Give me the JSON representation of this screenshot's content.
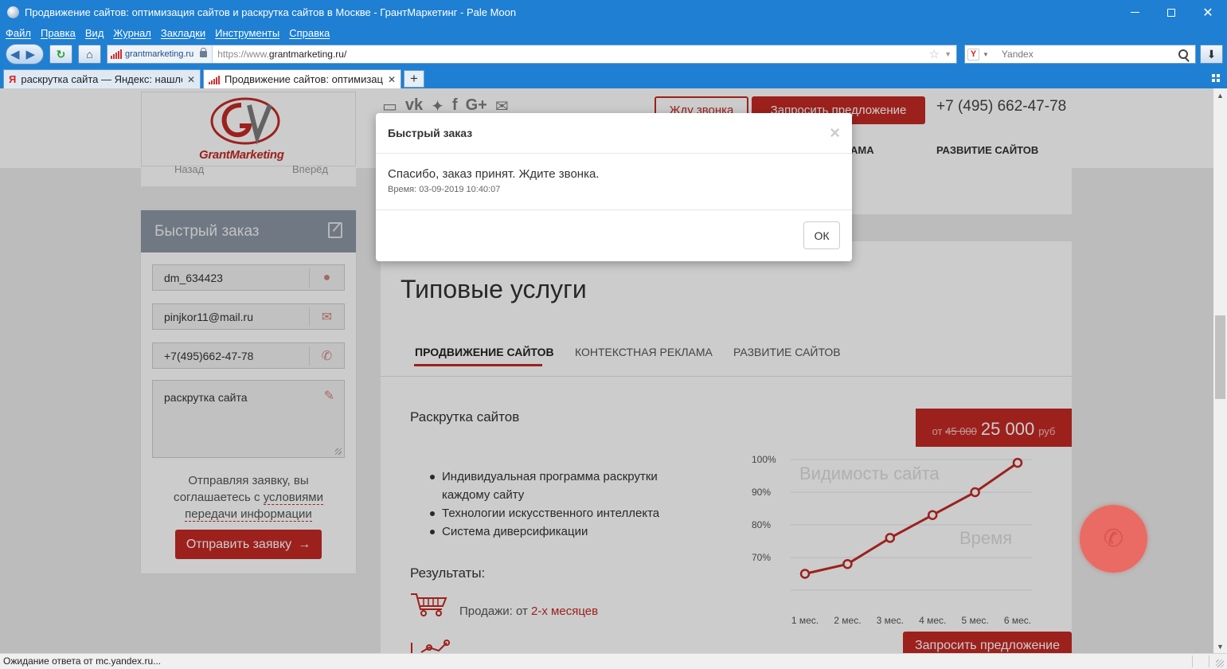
{
  "window": {
    "title": "Продвижение сайтов: оптимизация сайтов и раскрутка сайтов в Москве - ГрантМаркетинг - Pale Moon"
  },
  "menu": [
    "Файл",
    "Правка",
    "Вид",
    "Журнал",
    "Закладки",
    "Инструменты",
    "Справка"
  ],
  "urlbar": {
    "site_badge": "grantmarketing.ru",
    "url_prefix": "https://www.",
    "url_host": "grantmarketing.ru/"
  },
  "searchbar": {
    "engine": "Yandex",
    "badge": "Y"
  },
  "tabs": [
    {
      "label": "раскрутка сайта — Яндекс: нашло...",
      "favicon": "Я",
      "active": false
    },
    {
      "label": "Продвижение сайтов: оптимизац...",
      "active": true
    }
  ],
  "site": {
    "logo_text": "GrantMarketing",
    "call_button": "Жду звонка",
    "offer_button": "Запросить предложение",
    "phone": "+7 (495) 662-47-78",
    "nav_partial": "АМА",
    "nav_item": "РАЗВИТИЕ САЙТОВ",
    "under_left": "Назад",
    "under_right": "Вперёд"
  },
  "quick_order": {
    "title": "Быстрый заказ",
    "name": "dm_634423",
    "email": "pinjkor11@mail.ru",
    "phone": "+7(495)662-47-78",
    "message": "раскрутка сайта",
    "agree_before": "Отправляя заявку, вы соглашаетесь с ",
    "agree_link": "условиями передачи информации",
    "send_button": "Отправить заявку"
  },
  "services": {
    "title": "Типовые услуги",
    "tabs": [
      "ПРОДВИЖЕНИЕ САЙТОВ",
      "КОНТЕКСТНАЯ РЕКЛАМА",
      "РАЗВИТИЕ САЙТОВ"
    ],
    "offer_title": "Раскрутка сайтов",
    "price": {
      "from": "от",
      "old": "45 000",
      "new": "25 000",
      "currency": "руб"
    },
    "bullets": [
      "Индивидуальная программа раскрутки каждому сайту",
      "Технологии искусственного интеллекта",
      "Система диверсификации"
    ],
    "results_title": "Результаты:",
    "sales_label": "Продажи: от ",
    "sales_value": "2-х месяцев",
    "offer_button": "Запросить предложение"
  },
  "chart_data": {
    "type": "line",
    "title": "Видимость сайта",
    "xlabel": "Время",
    "categories": [
      "1 мес.",
      "2 мес.",
      "3 мес.",
      "4 мес.",
      "5 мес.",
      "6 мес."
    ],
    "series": [
      {
        "values": [
          65,
          68,
          76,
          83,
          90,
          99
        ]
      }
    ],
    "yticks": [
      "100%",
      "90%",
      "80%",
      "70%"
    ],
    "ylim": [
      60,
      100
    ],
    "color": "#c42a25",
    "grid": true
  },
  "modal": {
    "title": "Быстрый заказ",
    "close": "×",
    "message": "Спасибо, заказ принят. Ждите звонка.",
    "time": "Время: 03-09-2019 10:40:07",
    "ok_button": "ОК"
  },
  "status": {
    "text": "Ожидание ответа от mc.yandex.ru..."
  },
  "colors": {
    "chrome": "#1f7fd2",
    "brand_red": "#c42a25",
    "fab": "#e96b63"
  }
}
